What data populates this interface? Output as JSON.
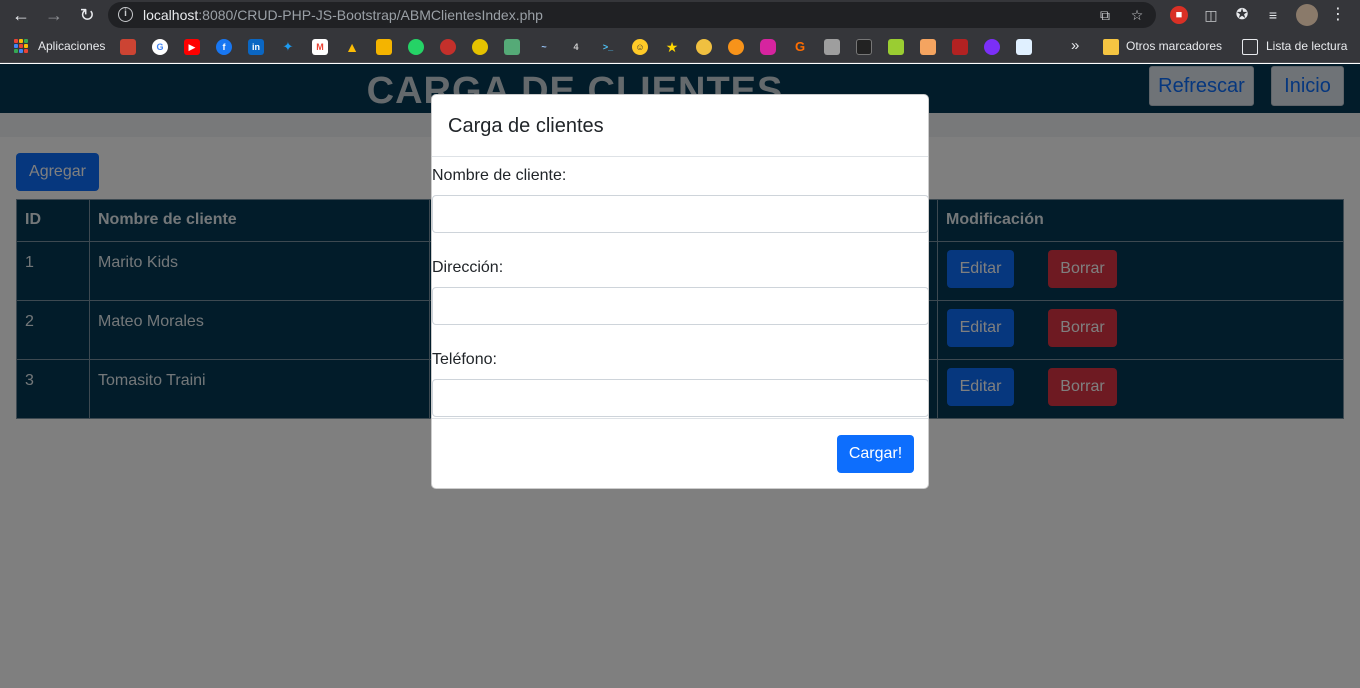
{
  "browser": {
    "url_host": "localhost",
    "url_rest": ":8080/CRUD-PHP-JS-Bootstrap/ABMClientesIndex.php",
    "bookmarks": {
      "apps_label": "Aplicaciones",
      "other_label": "Otros marcadores",
      "reading_list_label": "Lista de lectura",
      "overflow": "»"
    }
  },
  "page": {
    "title": "CARGA DE CLIENTES",
    "refresh_label": "Refrescar",
    "home_label": "Inicio",
    "add_label": "Agregar"
  },
  "table": {
    "headers": {
      "id": "ID",
      "name": "Nombre de cliente",
      "address": "",
      "phone": "",
      "actions": "Modificación"
    },
    "rows": [
      {
        "id": "1",
        "name": "Marito Kids",
        "edit": "Editar",
        "delete": "Borrar"
      },
      {
        "id": "2",
        "name": "Mateo Morales",
        "edit": "Editar",
        "delete": "Borrar"
      },
      {
        "id": "3",
        "name": "Tomasito Traini",
        "edit": "Editar",
        "delete": "Borrar"
      }
    ]
  },
  "modal": {
    "title": "Carga de clientes",
    "name_label": "Nombre de cliente:",
    "name_value": "",
    "address_label": "Dirección:",
    "address_value": "",
    "phone_label": "Teléfono:",
    "phone_value": "",
    "submit_label": "Cargar!"
  },
  "colors": {
    "header_bg": "#053854",
    "primary": "#0d6efd",
    "danger": "#dc3545"
  }
}
